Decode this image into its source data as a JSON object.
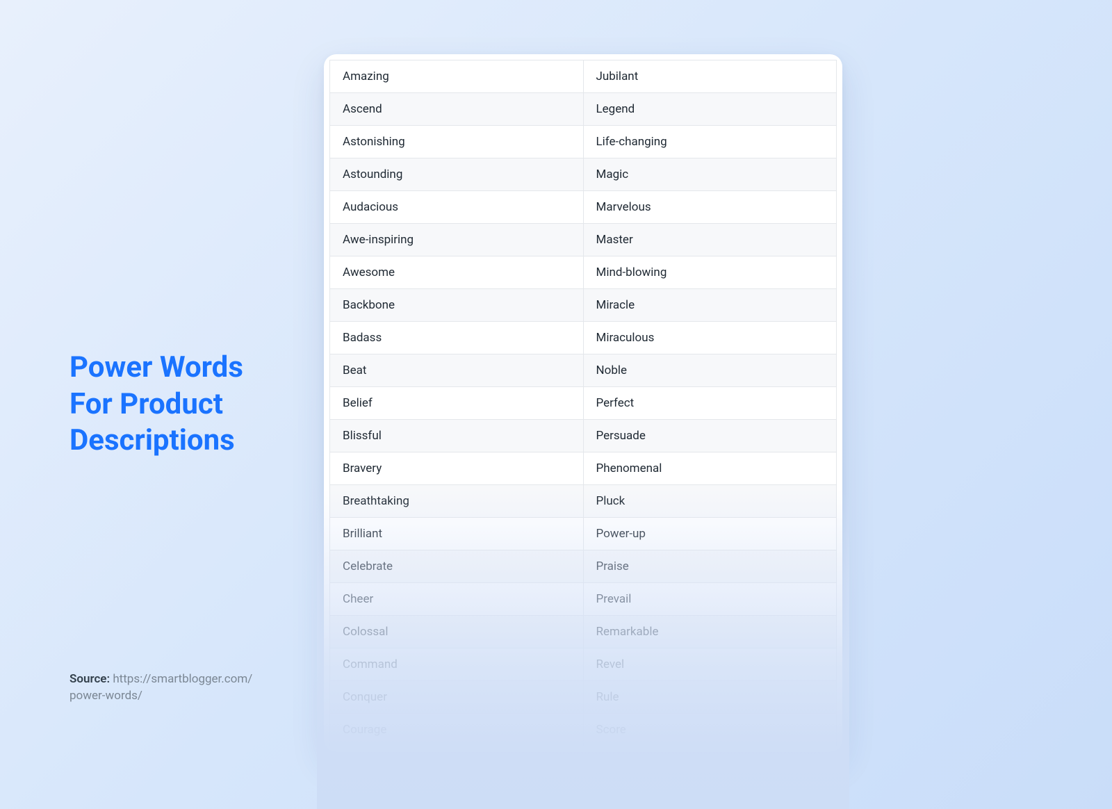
{
  "title_line1": "Power Words",
  "title_line2": "For Product",
  "title_line3": "Descriptions",
  "source_label": "Source:",
  "source_url_line1": "https://smartblogger.com/",
  "source_url_line2": "power-words/",
  "words": {
    "left": [
      "Amazing",
      "Ascend",
      "Astonishing",
      "Astounding",
      "Audacious",
      "Awe-inspiring",
      "Awesome",
      "Backbone",
      "Badass",
      "Beat",
      "Belief",
      "Blissful",
      "Bravery",
      "Breathtaking",
      "Brilliant",
      "Celebrate",
      "Cheer",
      "Colossal",
      "Command",
      "Conquer",
      "Courage"
    ],
    "right": [
      "Jubilant",
      "Legend",
      "Life-changing",
      "Magic",
      "Marvelous",
      "Master",
      "Mind-blowing",
      "Miracle",
      "Miraculous",
      "Noble",
      "Perfect",
      "Persuade",
      "Phenomenal",
      "Pluck",
      "Power-up",
      "Praise",
      "Prevail",
      "Remarkable",
      "Revel",
      "Rule",
      "Score"
    ]
  }
}
